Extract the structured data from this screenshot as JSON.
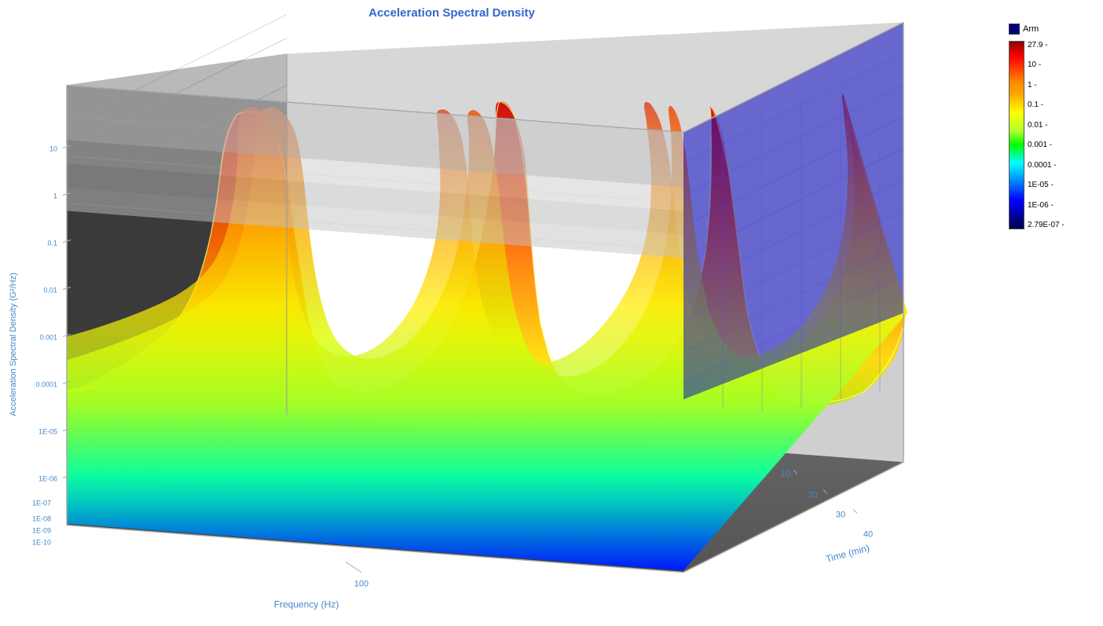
{
  "title": "Acceleration Spectral Density",
  "yAxisLabel": "Acceleration Spectral Density (G²/Hz)",
  "xAxisLabel": "Frequency (Hz)",
  "timeAxisLabel": "Time (min)",
  "yTicks": [
    "10",
    "1",
    "0.1",
    "0.01",
    "0.001",
    "0.0001",
    "1E-05",
    "1E-06",
    "1E-07",
    "1E-08",
    "1E-09",
    "1E-10"
  ],
  "xTicks": [
    "100"
  ],
  "timeTicks": [
    "10",
    "20",
    "30",
    "40"
  ],
  "legend": {
    "armLabel": "Arm",
    "colorbarlabels": [
      "27.9 -",
      "10 -",
      "1 -",
      "0.1 -",
      "0.01 -",
      "0.001 -",
      "0.0001 -",
      "1E-05 -",
      "1E-06 -",
      "2.79E-07 -"
    ],
    "colorbarAxisLabel": "Acceleration Spectral Density  (G²/Hz)"
  },
  "colors": {
    "title": "#3366cc",
    "axisLabel": "#4488cc",
    "background": "#ffffff",
    "plotFloor": "#444444",
    "gridLines": "#666666"
  }
}
